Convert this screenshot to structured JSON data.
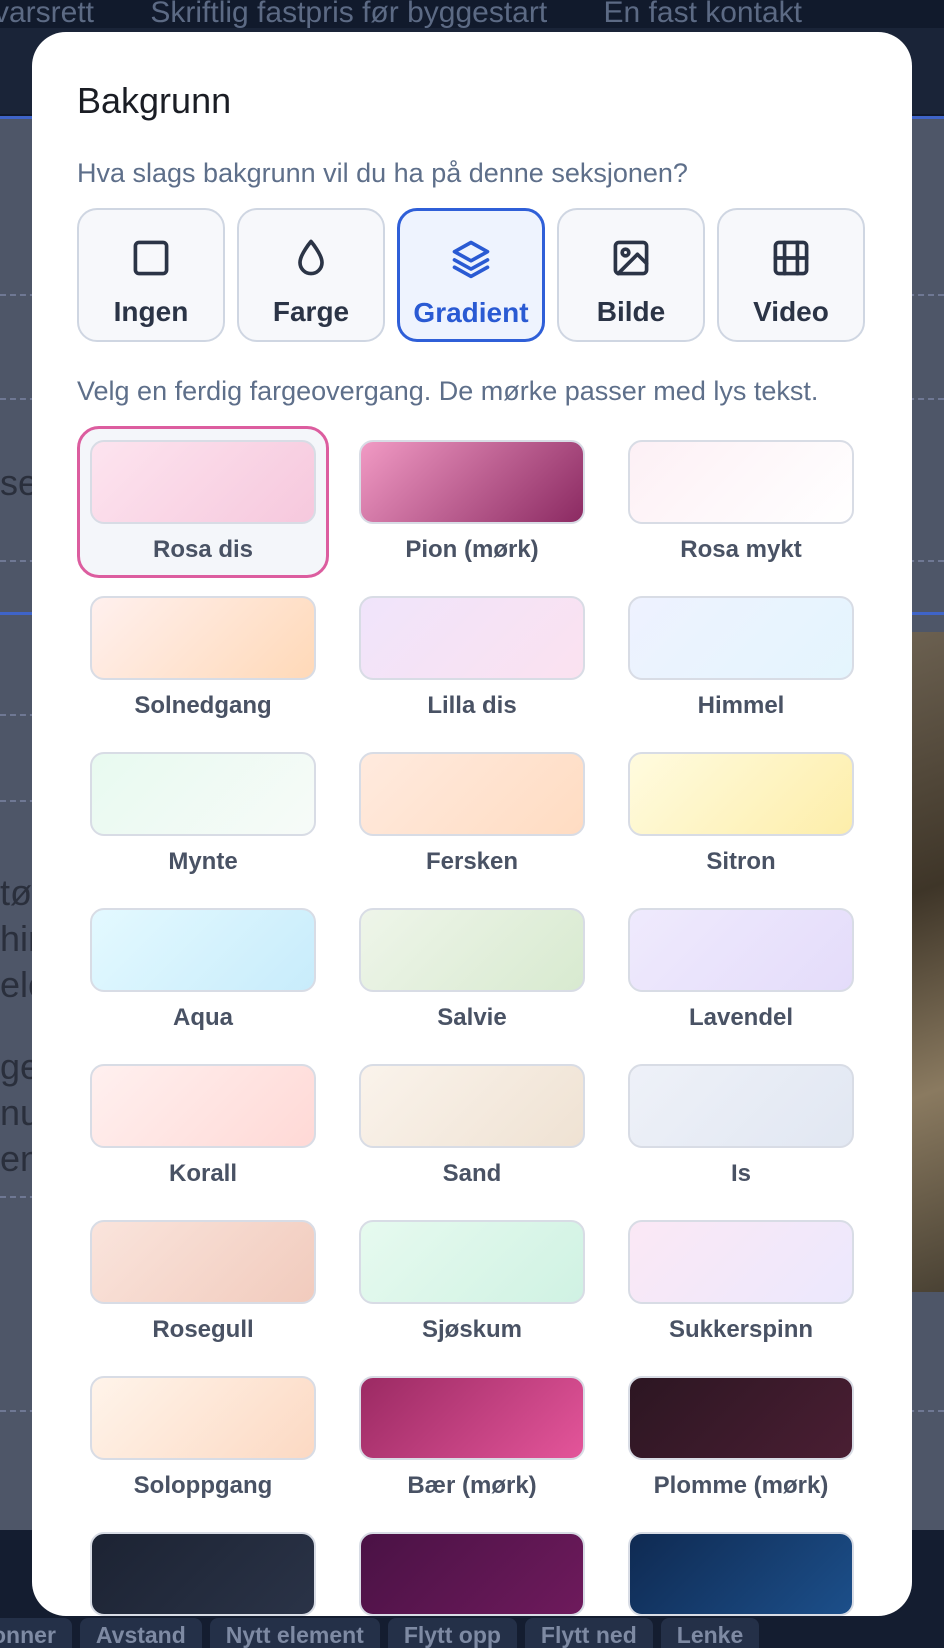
{
  "background_page": {
    "nav_items": [
      "varsrett",
      "Skriftlig fastpris før byggestart",
      "En fast kontakt"
    ],
    "toolbar": [
      "onner",
      "Avstand",
      "Nytt element",
      "Flytt opp",
      "Flytt ned",
      "Lenke"
    ],
    "left_fragments": [
      "se",
      "tør",
      "hin",
      "ele",
      "ge",
      "nu",
      "en"
    ]
  },
  "modal": {
    "title": "Bakgrunn",
    "question": "Hva slags bakgrunn vil du ha på denne seksjonen?",
    "hint": "Velg en ferdig fargeovergang. De mørke passer med lys tekst.",
    "types": [
      {
        "label": "Ingen",
        "icon": "square-icon",
        "active": false
      },
      {
        "label": "Farge",
        "icon": "droplet-icon",
        "active": false
      },
      {
        "label": "Gradient",
        "icon": "layers-icon",
        "active": true
      },
      {
        "label": "Bilde",
        "icon": "image-icon",
        "active": false
      },
      {
        "label": "Video",
        "icon": "film-icon",
        "active": false
      }
    ],
    "gradients": [
      {
        "label": "Rosa dis",
        "from": "#fde4ef",
        "to": "#f6c8dd",
        "selected": true
      },
      {
        "label": "Pion (mørk)",
        "from": "#f19ac4",
        "to": "#8b2a62",
        "selected": false
      },
      {
        "label": "Rosa mykt",
        "from": "#fdf0f5",
        "to": "#ffffff",
        "selected": false
      },
      {
        "label": "Solnedgang",
        "from": "#fff0ee",
        "to": "#ffd9b8",
        "selected": false
      },
      {
        "label": "Lilla dis",
        "from": "#f0e4fb",
        "to": "#fbe2f0",
        "selected": false
      },
      {
        "label": "Himmel",
        "from": "#eef2ff",
        "to": "#e4f5fd",
        "selected": false
      },
      {
        "label": "Mynte",
        "from": "#e8faf0",
        "to": "#f7fbf8",
        "selected": false
      },
      {
        "label": "Fersken",
        "from": "#ffeade",
        "to": "#ffdcc2",
        "selected": false
      },
      {
        "label": "Sitron",
        "from": "#fffbdf",
        "to": "#fdeeaa",
        "selected": false
      },
      {
        "label": "Aqua",
        "from": "#e3f9ff",
        "to": "#c8ecfb",
        "selected": false
      },
      {
        "label": "Salvie",
        "from": "#eef5e9",
        "to": "#d8ead0",
        "selected": false
      },
      {
        "label": "Lavendel",
        "from": "#efeafd",
        "to": "#e4dcfa",
        "selected": false
      },
      {
        "label": "Korall",
        "from": "#fff0ef",
        "to": "#ffd9d6",
        "selected": false
      },
      {
        "label": "Sand",
        "from": "#faf3eb",
        "to": "#efe2d3",
        "selected": false
      },
      {
        "label": "Is",
        "from": "#eef1f8",
        "to": "#e1e7f2",
        "selected": false
      },
      {
        "label": "Rosegull",
        "from": "#fae4dc",
        "to": "#f1cbbd",
        "selected": false
      },
      {
        "label": "Sjøskum",
        "from": "#e6faef",
        "to": "#d0f2e3",
        "selected": false
      },
      {
        "label": "Sukkerspinn",
        "from": "#fbe8f5",
        "to": "#ece8fd",
        "selected": false
      },
      {
        "label": "Soloppgang",
        "from": "#fff4ea",
        "to": "#fcd9c3",
        "selected": false
      },
      {
        "label": "Bær (mørk)",
        "from": "#9b2a63",
        "to": "#e4559a",
        "selected": false
      },
      {
        "label": "Plomme (mørk)",
        "from": "#2c1622",
        "to": "#4a1e33",
        "selected": false
      },
      {
        "label": "",
        "from": "#1c2333",
        "to": "#2a3347",
        "selected": false
      },
      {
        "label": "",
        "from": "#4a1245",
        "to": "#6e1a5c",
        "selected": false
      },
      {
        "label": "",
        "from": "#0f2a52",
        "to": "#1c4f8a",
        "selected": false
      }
    ]
  }
}
